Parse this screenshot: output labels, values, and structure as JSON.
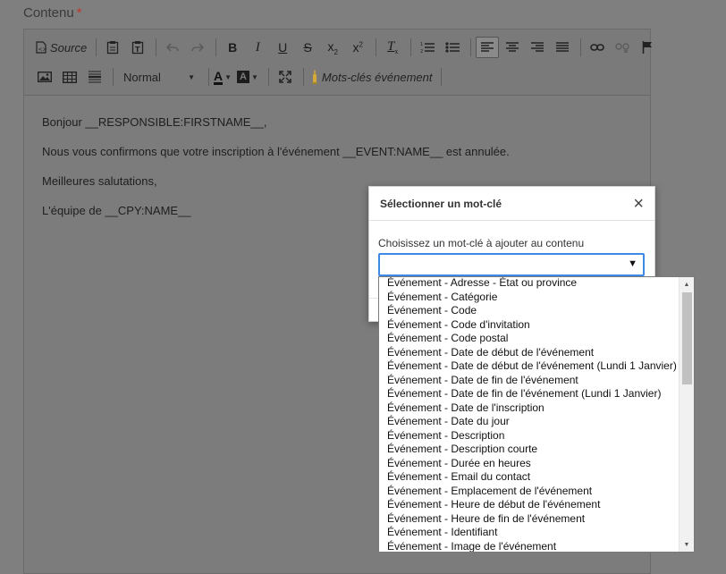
{
  "field": {
    "label": "Contenu",
    "required_mark": "*"
  },
  "toolbar": {
    "source_label": "Source",
    "format_value": "Normal",
    "keywords_label": "Mots-clés événement"
  },
  "content": {
    "paragraphs": [
      "Bonjour __RESPONSIBLE:FIRSTNAME__,",
      "Nous vous confirmons que votre inscription à l'événement __EVENT:NAME__ est annulée.",
      "Meilleures salutations,",
      "L'équipe de __CPY:NAME__"
    ]
  },
  "dialog": {
    "title": "Sélectionner un mot-clé",
    "close": "×",
    "prompt": "Choisissez un mot-clé à ajouter au contenu",
    "select_value": ""
  },
  "dropdown": {
    "options": [
      "Événement - Adresse - État ou province",
      "Événement - Catégorie",
      "Événement - Code",
      "Événement - Code d'invitation",
      "Événement - Code postal",
      "Événement - Date de début de l'événement",
      "Événement - Date de début de l'événement (Lundi 1 Janvier)",
      "Événement - Date de fin de l'événement",
      "Événement - Date de fin de l'événement (Lundi 1 Janvier)",
      "Événement - Date de l'inscription",
      "Événement - Date du jour",
      "Événement - Description",
      "Événement - Description courte",
      "Événement - Durée en heures",
      "Événement - Email du contact",
      "Événement - Emplacement de l'événement",
      "Événement - Heure de début de l'événement",
      "Événement - Heure de fin de l'événement",
      "Événement - Identifiant",
      "Événement - Image de l'événement"
    ]
  },
  "colors": {
    "focus": "#3c8ae6",
    "overlay": "#7f7f7f",
    "required": "#c0392b"
  }
}
